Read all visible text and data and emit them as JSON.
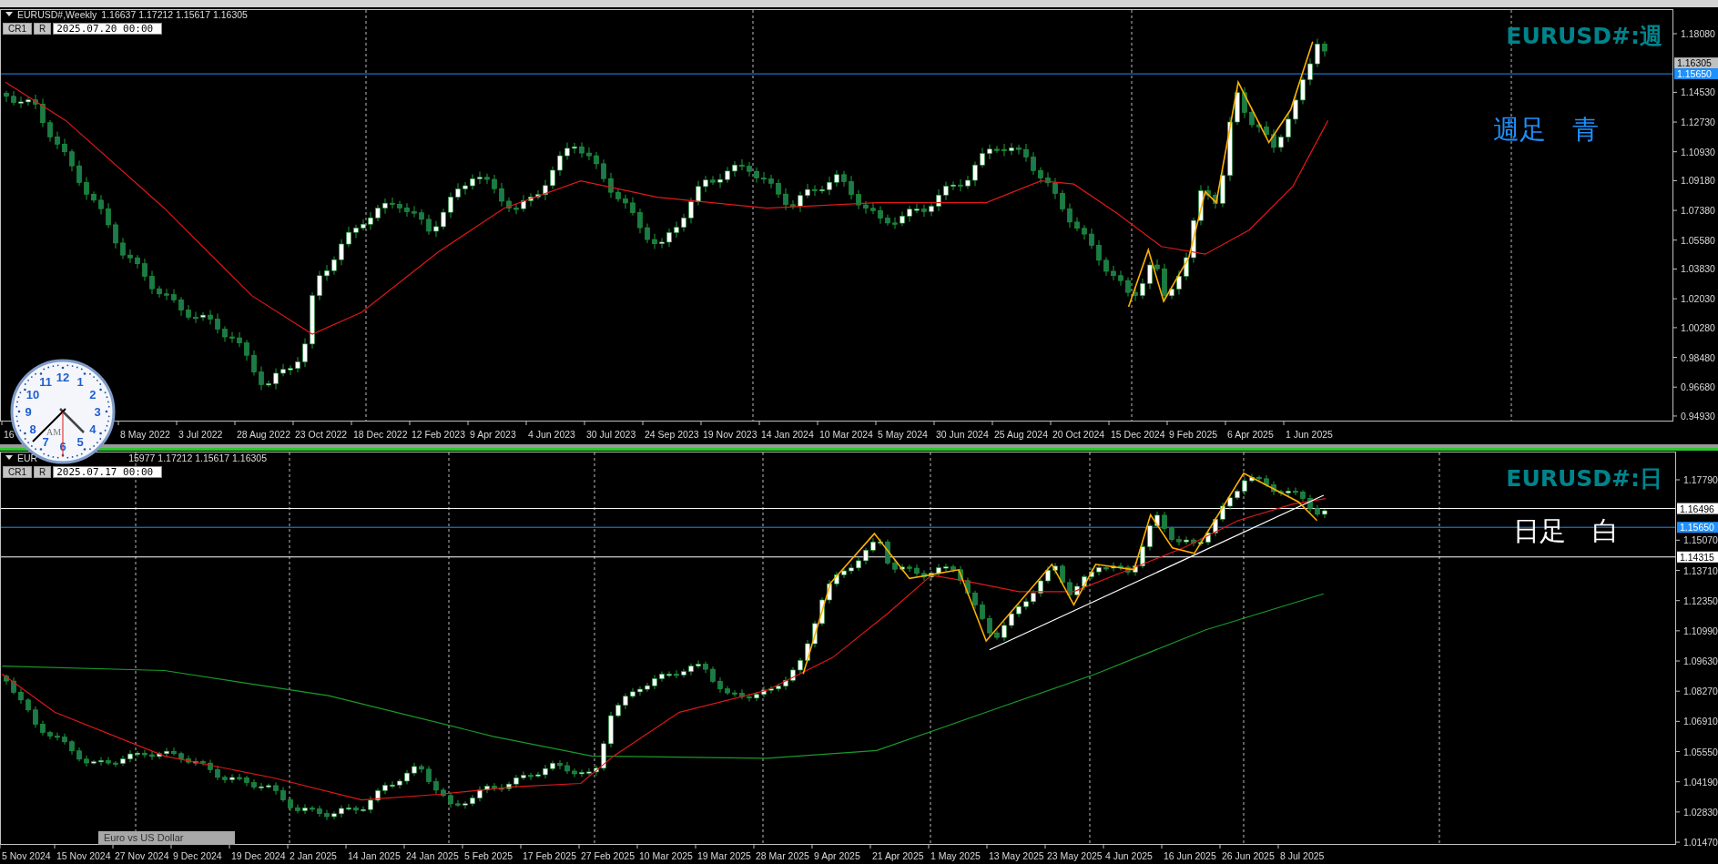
{
  "top_chart": {
    "header": {
      "symbol": "EURUSD#,Weekly",
      "quotes": "1.16637 1.17212 1.15617 1.16305"
    },
    "buttons": [
      {
        "label": "CR1"
      },
      {
        "label": "R"
      }
    ],
    "date_field": "2025.07.20 00:00",
    "title": "EURUSD#:週",
    "note": "週足　青",
    "price_labels": [
      "1.18080",
      "1.14530",
      "1.12730",
      "1.10930",
      "1.09180",
      "1.07380",
      "1.05580",
      "1.03830",
      "1.02030",
      "1.00280",
      "0.98480",
      "0.96680",
      "0.94930"
    ],
    "price_tags": [
      {
        "kind": "bid",
        "value": "1.16305"
      },
      {
        "kind": "line",
        "value": "1.15650",
        "color": "#1e90ff"
      }
    ],
    "dates": [
      "16",
      "8 May 2022",
      "3 Jul 2022",
      "28 Aug 2022",
      "23 Oct 2022",
      "18 Dec 2022",
      "12 Feb 2023",
      "9 Apr 2023",
      "4 Jun 2023",
      "30 Jul 2023",
      "24 Sep 2023",
      "19 Nov 2023",
      "14 Jan 2024",
      "10 Mar 2024",
      "5 May 2024",
      "30 Jun 2024",
      "25 Aug 2024",
      "20 Oct 2024",
      "15 Dec 2024",
      "9 Feb 2025",
      "6 Apr 2025",
      "1 Jun 2025"
    ]
  },
  "bottom_chart": {
    "header": {
      "symbol": "EUR",
      "quotes": "15977 1.17212 1.15617 1.16305"
    },
    "buttons": [
      {
        "label": "CR1"
      },
      {
        "label": "R"
      }
    ],
    "date_field": "2025.07.17 00:00",
    "title": "EURUSD#:日",
    "note": "日足　白",
    "price_labels": [
      "1.17790",
      "1.15070",
      "1.13710",
      "1.12350",
      "1.10990",
      "1.09630",
      "1.08270",
      "1.06910",
      "1.05550",
      "1.04190",
      "1.02830",
      "1.01470"
    ],
    "price_tags": [
      {
        "kind": "line",
        "value": "1.16496",
        "color": "#ffffff"
      },
      {
        "kind": "line",
        "value": "1.15650",
        "color": "#1e90ff"
      },
      {
        "kind": "line",
        "value": "1.14315",
        "color": "#ffffff"
      }
    ],
    "dates": [
      "5 Nov 2024",
      "15 Nov 2024",
      "27 Nov 2024",
      "9 Dec 2024",
      "19 Dec 2024",
      "2 Jan 2025",
      "14 Jan 2025",
      "24 Jan 2025",
      "5 Feb 2025",
      "17 Feb 2025",
      "27 Feb 2025",
      "10 Mar 2025",
      "19 Mar 2025",
      "28 Mar 2025",
      "9 Apr 2025",
      "21 Apr 2025",
      "1 May 2025",
      "13 May 2025",
      "23 May 2025",
      "4 Jun 2025",
      "16 Jun 2025",
      "26 Jun 2025",
      "8 Jul 2025"
    ]
  },
  "clock": {
    "numbers": [
      "12",
      "11",
      "1",
      "10",
      "2",
      "9",
      "3",
      "8",
      "4",
      "7",
      "5",
      "6"
    ],
    "meridiem": "AM"
  },
  "tooltip": {
    "text": "Euro vs US Dollar"
  }
}
